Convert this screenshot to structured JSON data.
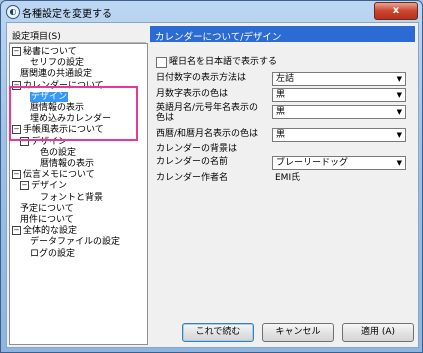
{
  "window": {
    "title": "各種設定を変更する",
    "close": "x"
  },
  "left": {
    "header": "設定項目(S)",
    "tree": [
      {
        "label": "秘書について",
        "level": 0,
        "toggle": "⊟"
      },
      {
        "label": "セリフの設定",
        "level": 2
      },
      {
        "label": "暦関連の共通設定",
        "level": 1
      },
      {
        "label": "カレンダーについて",
        "level": 0,
        "toggle": "⊟"
      },
      {
        "label": "デザイン",
        "level": 2,
        "selected": true
      },
      {
        "label": "暦情報の表示",
        "level": 2
      },
      {
        "label": "埋め込みカレンダー",
        "level": 2
      },
      {
        "label": "手帳風表示について",
        "level": 0,
        "toggle": "⊟"
      },
      {
        "label": "デザイン",
        "level": 1,
        "toggle": "⊟"
      },
      {
        "label": "色の設定",
        "level": 3
      },
      {
        "label": "暦情報の表示",
        "level": 3
      },
      {
        "label": "伝言メモについて",
        "level": 0,
        "toggle": "⊟"
      },
      {
        "label": "デザイン",
        "level": 1,
        "toggle": "⊟"
      },
      {
        "label": "フォントと背景",
        "level": 3
      },
      {
        "label": "予定について",
        "level": 1
      },
      {
        "label": "用件について",
        "level": 1
      },
      {
        "label": "全体的な設定",
        "level": 0,
        "toggle": "⊟"
      },
      {
        "label": "データファイルの設定",
        "level": 2
      },
      {
        "label": "ログの設定",
        "level": 2
      }
    ]
  },
  "right": {
    "header": "カレンダーについて/デザイン",
    "weekday_japanese": "曜日名を日本語で表示する",
    "date_format_label": "日付数字の表示方法は",
    "date_format_value": "左詰",
    "month_color_label": "月数字表示の色は",
    "month_color_value": "黒",
    "english_month_label_1": "英語月名/元号年名表示の",
    "english_month_label_2": "色は",
    "english_month_value": "黒",
    "western_label": "西暦/和暦月名表示の色は",
    "western_value": "黒",
    "background_label": "カレンダーの背景は",
    "calendar_name_label": "カレンダーの名前",
    "calendar_name_value": "ブレーリードッグ",
    "author_label": "カレンダー作者名",
    "author_value": "EMI氏"
  },
  "buttons": {
    "ok": "これで続む",
    "cancel": "キャンセル",
    "apply": "適用 (A)"
  }
}
